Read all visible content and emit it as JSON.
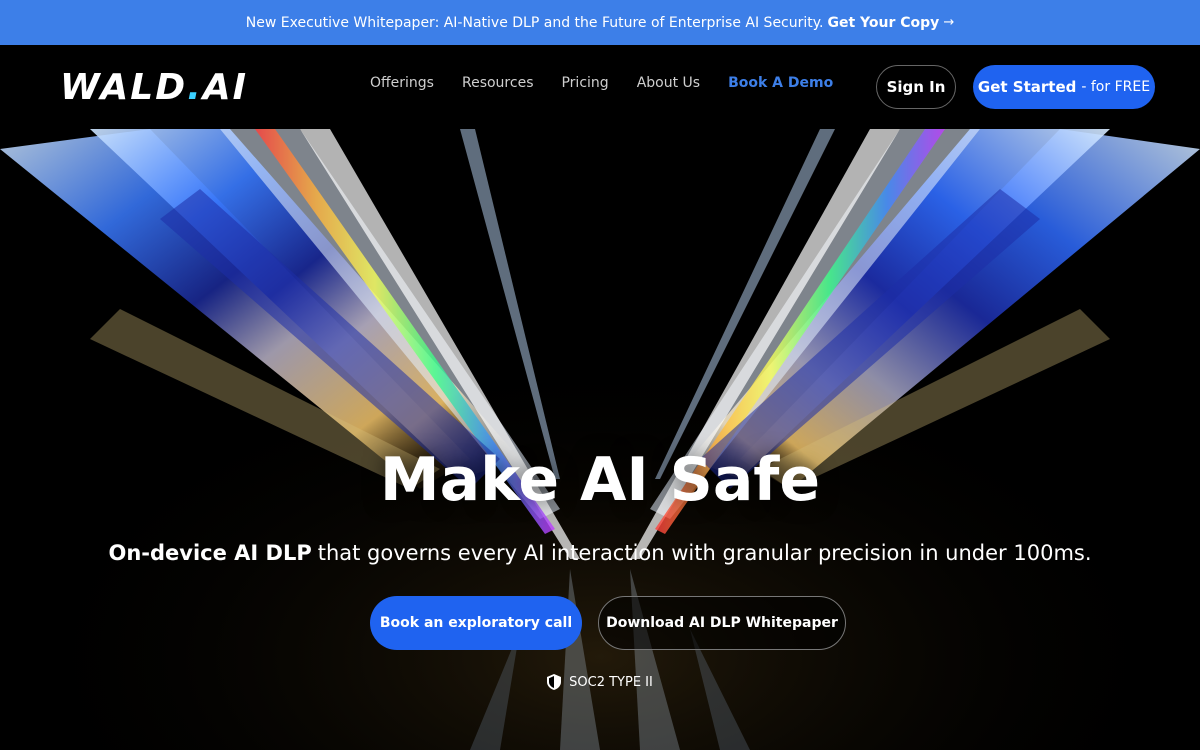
{
  "banner": {
    "text": "New Executive Whitepaper: AI-Native DLP and the Future of Enterprise AI Security.",
    "cta": "Get Your Copy",
    "arrow": "→"
  },
  "nav": {
    "logo_main": "WALD",
    "logo_dot": ".",
    "logo_suffix": "AI",
    "links": [
      "Offerings",
      "Resources",
      "Pricing",
      "About Us"
    ],
    "demo": "Book A Demo",
    "sign_in": "Sign In",
    "get_started": "Get Started",
    "get_started_suffix": "- for FREE"
  },
  "hero": {
    "headline": "Make AI Safe",
    "subline_strong": "On-device AI DLP",
    "subline_rest": "that governs every AI interaction with granular precision in under 100ms.",
    "primary_button": "Book an exploratory call",
    "secondary_button": "Download AI DLP Whitepaper",
    "badge": "SOC2 TYPE II"
  },
  "colors": {
    "banner": "#3d7fe8",
    "accent_blue": "#1f63f0",
    "demo_link": "#3d7fe8",
    "background": "#000000"
  }
}
